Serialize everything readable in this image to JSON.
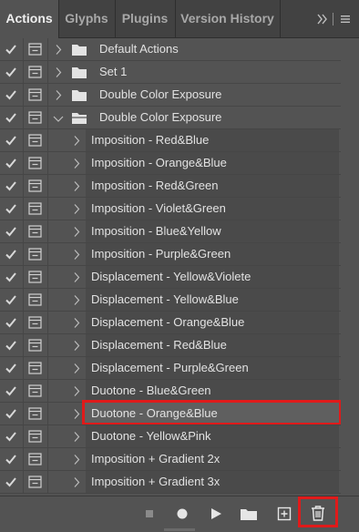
{
  "tabs": [
    {
      "label": "Actions",
      "active": true
    },
    {
      "label": "Glyphs",
      "active": false
    },
    {
      "label": "Plugins",
      "active": false
    },
    {
      "label": "Version History",
      "active": false
    }
  ],
  "tabbar_right": {
    "expand_icon": "double-chevron-right-icon",
    "menu_icon": "hamburger-menu-icon"
  },
  "rows": [
    {
      "label": "Default Actions",
      "kind": "set",
      "expanded": false
    },
    {
      "label": "Set 1",
      "kind": "set",
      "expanded": false
    },
    {
      "label": "Double Color Exposure",
      "kind": "set",
      "expanded": false
    },
    {
      "label": "Double Color Exposure",
      "kind": "set",
      "expanded": true
    },
    {
      "label": "Imposition - Red&Blue",
      "kind": "action"
    },
    {
      "label": "Imposition - Orange&Blue",
      "kind": "action"
    },
    {
      "label": "Imposition - Red&Green",
      "kind": "action"
    },
    {
      "label": "Imposition - Violet&Green",
      "kind": "action"
    },
    {
      "label": "Imposition - Blue&Yellow",
      "kind": "action"
    },
    {
      "label": "Imposition - Purple&Green",
      "kind": "action"
    },
    {
      "label": "Displacement - Yellow&Violete",
      "kind": "action"
    },
    {
      "label": "Displacement - Yellow&Blue",
      "kind": "action"
    },
    {
      "label": "Displacement - Orange&Blue",
      "kind": "action"
    },
    {
      "label": "Displacement - Red&Blue",
      "kind": "action"
    },
    {
      "label": "Displacement - Purple&Green",
      "kind": "action"
    },
    {
      "label": "Duotone - Blue&Green",
      "kind": "action"
    },
    {
      "label": "Duotone - Orange&Blue",
      "kind": "action",
      "selected": true
    },
    {
      "label": "Duotone - Yellow&Pink",
      "kind": "action"
    },
    {
      "label": "Imposition + Gradient 2x",
      "kind": "action"
    },
    {
      "label": "Imposition + Gradient 3x",
      "kind": "action"
    }
  ],
  "toolbar": {
    "buttons": [
      "stop-icon",
      "record-icon",
      "play-icon",
      "new-set-folder-icon",
      "new-action-icon",
      "trash-icon"
    ]
  },
  "colors": {
    "highlight": "#e01a1a"
  }
}
